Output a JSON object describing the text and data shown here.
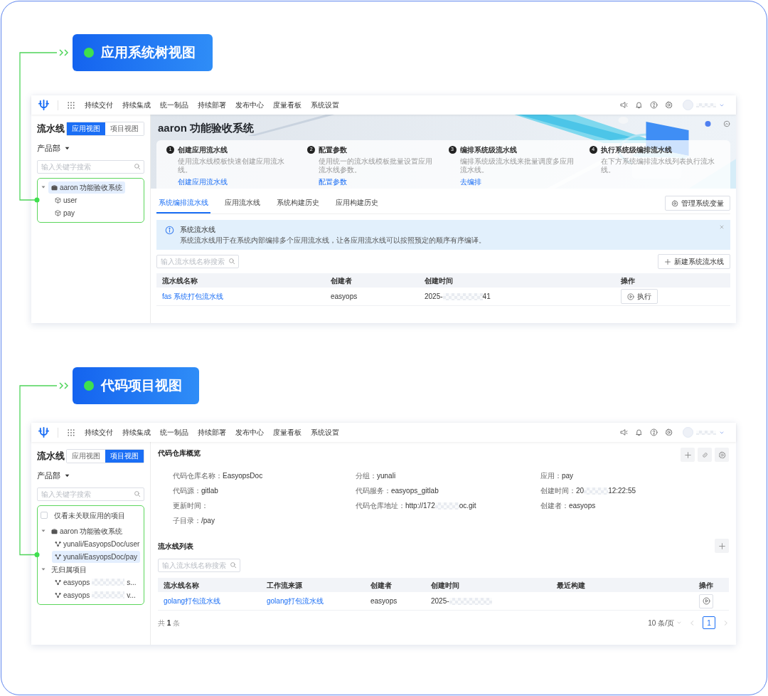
{
  "sections": [
    {
      "badge": "应用系统树视图",
      "app": {
        "kind": "app_view",
        "nav": {
          "items": [
            "持续交付",
            "持续集成",
            "统一制品",
            "持续部署",
            "发布中心",
            "度量看板",
            "系统设置"
          ]
        },
        "sidebar": {
          "title": "流水线",
          "views": [
            {
              "label": "应用视图",
              "selected": true
            },
            {
              "label": "项目视图",
              "selected": false
            }
          ],
          "scope": "产品部",
          "search": {
            "placeholder": "输入关键字搜索"
          },
          "tree": [
            {
              "kind": "system",
              "label": "aaron 功能验收系统",
              "expanded": true,
              "selected": true,
              "children": [
                {
                  "kind": "app",
                  "label": "user",
                  "selected": false
                },
                {
                  "kind": "app",
                  "label": "pay",
                  "selected": false
                }
              ]
            }
          ]
        },
        "main": {
          "banner": {
            "title": "aaron 功能验收系统",
            "steps": [
              {
                "number": "1",
                "title": "创建应用流水线",
                "text": "使用流水线模板快速创建应用流水线。",
                "link": "创建应用流水线"
              },
              {
                "number": "2",
                "title": "配置参数",
                "text": "使用统一的流水线模板批量设置应用流水线参数。",
                "link": "配置参数"
              },
              {
                "number": "3",
                "title": "编排系统级流水线",
                "text": "编排系统级流水线来批量调度多应用流水线。",
                "link": "去编排"
              },
              {
                "number": "4",
                "title": "执行系统级编排流水线",
                "text": "在下方系统编排流水线列表执行流水线。"
              }
            ]
          },
          "tabs": [
            {
              "label": "系统编排流水线",
              "selected": true
            },
            {
              "label": "应用流水线",
              "selected": false
            },
            {
              "label": "系统构建历史",
              "selected": false
            },
            {
              "label": "应用构建历史",
              "selected": false
            }
          ],
          "tab_action": "管理系统变量",
          "notice": {
            "title": "系统流水线",
            "text": "系统流水线用于在系统内部编排多个应用流水线，让各应用流水线可以按照预定的顺序有序编译。"
          },
          "search": {
            "placeholder": "输入流水线名称搜索"
          },
          "create_button": "新建系统流水线",
          "table": {
            "columns": [
              "流水线名称",
              "创建者",
              "创建时间",
              "操作"
            ],
            "rows": [
              {
                "name": "fas 系统打包流水线",
                "creator": "easyops",
                "created": "2025-",
                "masked": true,
                "created_tail": "41",
                "action": "执行"
              }
            ]
          }
        }
      }
    },
    {
      "badge": "代码项目视图",
      "app": {
        "kind": "project_view",
        "nav": {
          "items": [
            "持续交付",
            "持续集成",
            "统一制品",
            "持续部署",
            "发布中心",
            "度量看板",
            "系统设置"
          ]
        },
        "sidebar": {
          "title": "流水线",
          "views": [
            {
              "label": "应用视图",
              "selected": false
            },
            {
              "label": "项目视图",
              "selected": true
            }
          ],
          "scope": "产品部",
          "search": {
            "placeholder": "输入关键字搜索"
          },
          "filter": {
            "label": "仅看未关联应用的项目",
            "checked": false
          },
          "tree": [
            {
              "kind": "system",
              "label": "aaron 功能验收系统",
              "expanded": true,
              "selected": false,
              "children": [
                {
                  "kind": "repo",
                  "label": "yunali/EasyopsDoc/user",
                  "selected": false
                },
                {
                  "kind": "repo",
                  "label": "yunali/EasyopsDoc/pay",
                  "selected": true
                }
              ]
            },
            {
              "kind": "group",
              "label": "无归属项目",
              "expanded": true,
              "selected": false,
              "children": [
                {
                  "kind": "repo",
                  "label": "easyops",
                  "masked": true,
                  "label_tail": "s...",
                  "selected": false
                },
                {
                  "kind": "repo",
                  "label": "easyops",
                  "masked": true,
                  "label_tail": "v...",
                  "selected": false
                }
              ]
            }
          ]
        },
        "main": {
          "overview": {
            "title": "代码仓库概览",
            "fields": [
              {
                "label": "代码仓库名称：",
                "value": "EasyopsDoc"
              },
              {
                "label": "分组：",
                "value": "yunali"
              },
              {
                "label": "应用：",
                "value": "pay"
              },
              {
                "label": "代码源：",
                "value": "gitlab"
              },
              {
                "label": "代码服务：",
                "value": "easyops_gitlab"
              },
              {
                "label": "创建时间：",
                "value": "20",
                "masked": true,
                "value_tail": "12:22:55"
              },
              {
                "label": "更新时间："
              },
              {
                "label": "代码仓库地址：",
                "value": "http://172",
                "masked": true,
                "value_tail": "oc.git"
              },
              {
                "label": "创建者：",
                "value": "easyops"
              },
              {
                "label": "子目录：",
                "value": "/pay"
              }
            ]
          },
          "pipelines": {
            "title": "流水线列表",
            "search": {
              "placeholder": "输入流水线名称搜索"
            },
            "table": {
              "columns": [
                "流水线名称",
                "工作流来源",
                "创建者",
                "创建时间",
                "最近构建",
                "操作"
              ],
              "rows": [
                {
                  "name": "golang打包流水线",
                  "source": "golang打包流水线",
                  "creator": "easyops",
                  "created": "2025-",
                  "masked": true
                }
              ]
            },
            "total": "共 **1** 条",
            "page_size": "10 条/页",
            "pages": [
              {
                "label": "1",
                "selected": true
              }
            ]
          }
        }
      }
    }
  ]
}
